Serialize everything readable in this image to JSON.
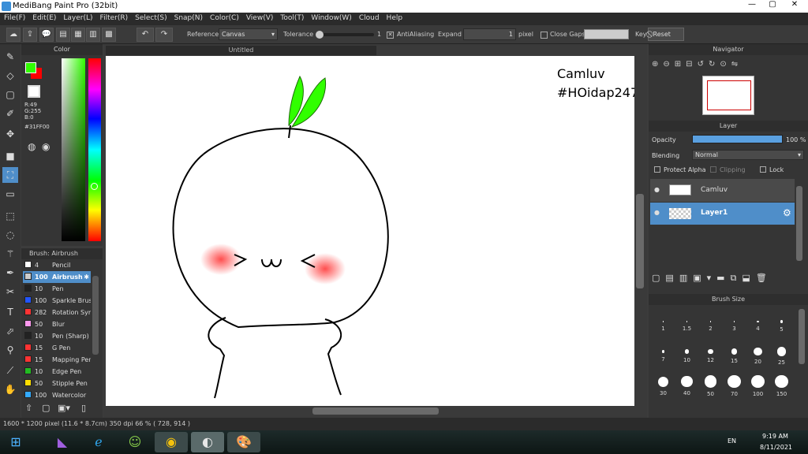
{
  "window": {
    "title": "MediBang Paint Pro (32bit)",
    "minimize": "—",
    "maximize": "▢",
    "close": "✕"
  },
  "menu": [
    "File(F)",
    "Edit(E)",
    "Layer(L)",
    "Filter(R)",
    "Select(S)",
    "Snap(N)",
    "Color(C)",
    "View(V)",
    "Tool(T)",
    "Window(W)",
    "Cloud",
    "Help"
  ],
  "toolbar": {
    "reference_label": "Reference",
    "reference_value": "Canvas",
    "tolerance_label": "Tolerance",
    "tolerance_value": "1",
    "antialiasing_label": "AntiAliasing",
    "antialiasing_checked": true,
    "expand_label": "Expand",
    "expand_value": "1",
    "expand_unit": "pixel",
    "close_gaps_label": "Close Gaps",
    "close_gaps_checked": false,
    "key_label": "Key",
    "reset_label": "Reset"
  },
  "color_panel": {
    "title": "Color",
    "r": "R:49",
    "g": "G:255",
    "b": "B:0",
    "hex": "#31FF00",
    "foreground": "#31ff00",
    "background": "#ff0000"
  },
  "brush_panel": {
    "title": "Brush: Airbrush",
    "items": [
      {
        "size": "4",
        "name": "Pencil",
        "color": "#ffffff"
      },
      {
        "size": "100",
        "name": "Airbrush",
        "color": "#cccccc",
        "selected": true
      },
      {
        "size": "10",
        "name": "Pen",
        "color": "#222222"
      },
      {
        "size": "100",
        "name": "Sparkle Brush",
        "color": "#2255ff"
      },
      {
        "size": "282",
        "name": "Rotation Sym",
        "color": "#ff3333"
      },
      {
        "size": "50",
        "name": "Blur",
        "color": "#ff99ee"
      },
      {
        "size": "10",
        "name": "Pen (Sharp)",
        "color": "#222222"
      },
      {
        "size": "15",
        "name": "G Pen",
        "color": "#ff3333"
      },
      {
        "size": "15",
        "name": "Mapping Pen",
        "color": "#ff3333"
      },
      {
        "size": "10",
        "name": "Edge Pen",
        "color": "#22bb22"
      },
      {
        "size": "50",
        "name": "Stipple Pen",
        "color": "#ffdd00"
      },
      {
        "size": "100",
        "name": "Watercolor",
        "color": "#33aaff"
      }
    ]
  },
  "canvas": {
    "tab_title": "Untitled",
    "text_line1": "Camluv",
    "text_line2": "#HOidap247",
    "sprout_color": "#31ff00",
    "blush_color": "#ff3a3a"
  },
  "navigator": {
    "title": "Navigator"
  },
  "layer_panel": {
    "title": "Layer",
    "opacity_label": "Opacity",
    "opacity_value": "100 %",
    "opacity": 1.0,
    "blending_label": "Blending",
    "blending_value": "Normal",
    "protect_alpha": "Protect Alpha",
    "clipping": "Clipping",
    "lock": "Lock",
    "layers": [
      {
        "name": "Camluv",
        "selected": false
      },
      {
        "name": "Layer1",
        "selected": true
      }
    ]
  },
  "brush_size_panel": {
    "title": "Brush Size",
    "sizes": [
      "1",
      "1.5",
      "2",
      "3",
      "4",
      "5",
      "7",
      "10",
      "12",
      "15",
      "20",
      "25",
      "30",
      "40",
      "50",
      "70",
      "100",
      "150"
    ]
  },
  "status": {
    "dimensions": "1600 * 1200 pixel",
    "physical": "(11.6 * 8.7cm)",
    "dpi": "350 dpi",
    "zoom": "66 %",
    "cursor": "( 728, 914 )"
  },
  "taskbar": {
    "lang": "EN",
    "time": "9:19 AM",
    "date": "8/11/2021"
  }
}
